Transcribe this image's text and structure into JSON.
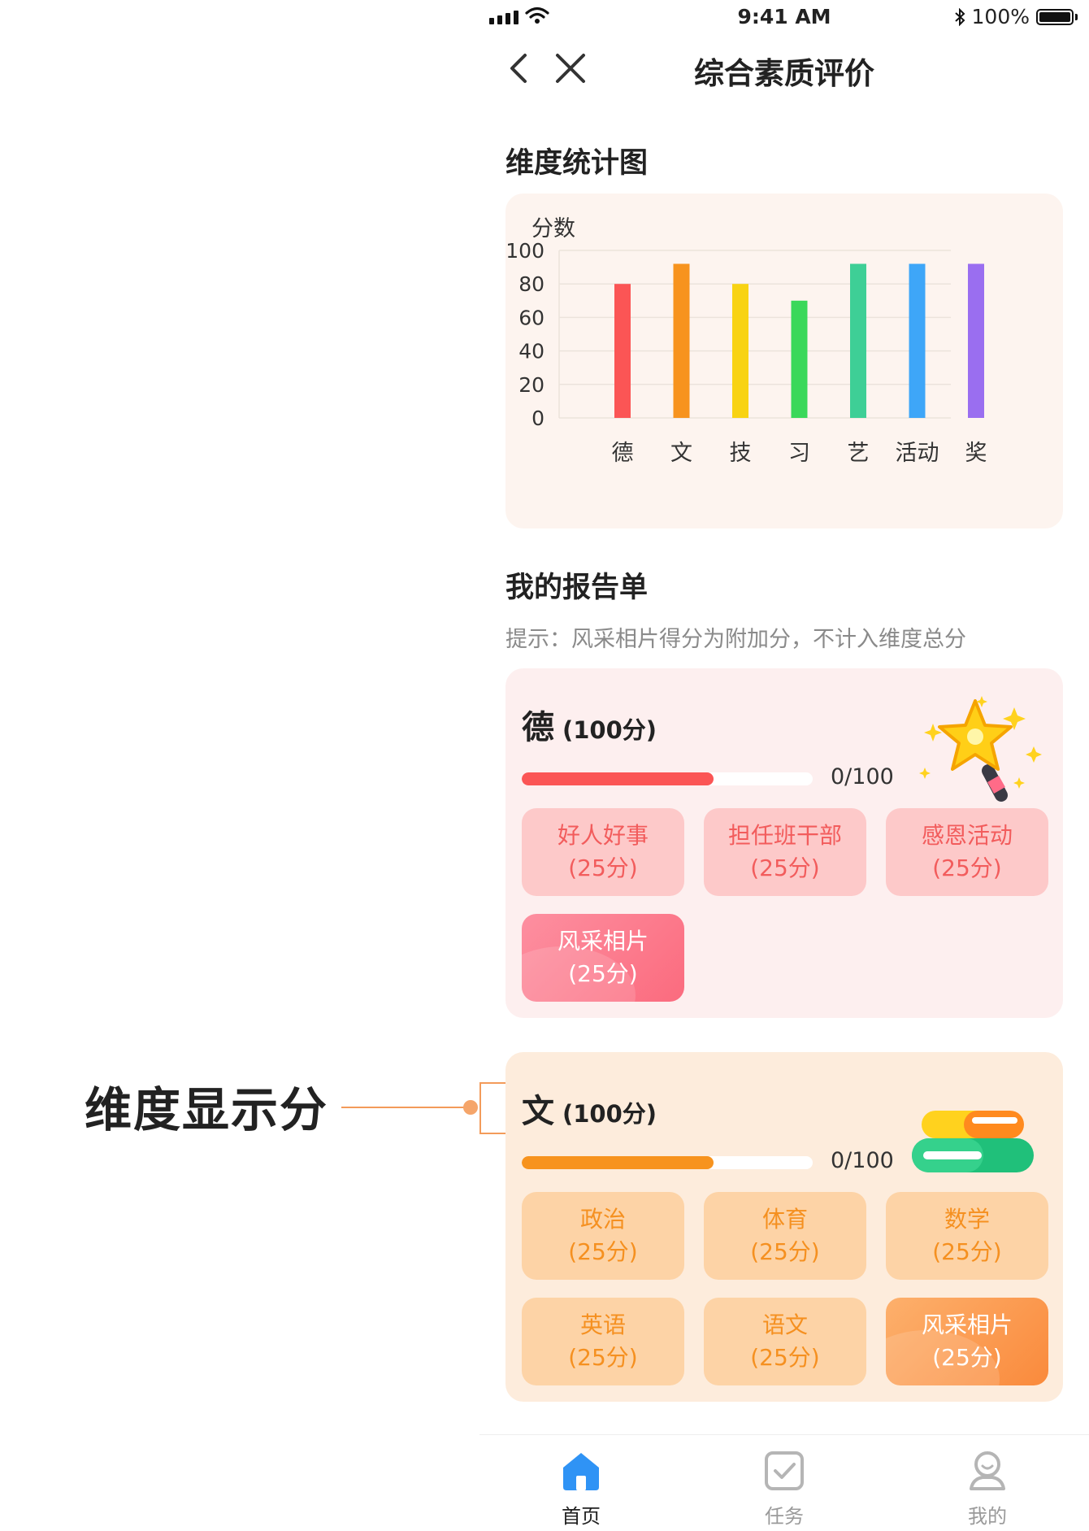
{
  "annotation": {
    "label": "维度显示分"
  },
  "statusbar": {
    "time": "9:41 AM",
    "battery": "100%"
  },
  "nav": {
    "title": "综合素质评价"
  },
  "chart_section": {
    "title": "维度统计图"
  },
  "chart_data": {
    "type": "bar",
    "ylabel": "分数",
    "ylim": [
      0,
      100
    ],
    "yticks": [
      "100",
      "80",
      "60",
      "40",
      "20",
      "0"
    ],
    "categories": [
      "德",
      "文",
      "技",
      "习",
      "艺",
      "活动",
      "奖"
    ],
    "values": [
      80,
      92,
      80,
      70,
      92,
      92,
      92
    ],
    "colors": [
      "#fb5555",
      "#f7931e",
      "#f8d313",
      "#3ad85a",
      "#3ecf96",
      "#3ea6f8",
      "#9a6ef0"
    ],
    "grid": true
  },
  "report": {
    "title": "我的报告单",
    "hint": "提示：风采相片得分为附加分，不计入维度总分",
    "cards": [
      {
        "name": "德",
        "score": "(100分)",
        "progress_text": "0/100",
        "progress": 0.66,
        "color": "#fb5555",
        "items": [
          {
            "name": "好人好事",
            "points": "(25分)"
          },
          {
            "name": "担任班干部",
            "points": "(25分)"
          },
          {
            "name": "感恩活动",
            "points": "(25分)"
          },
          {
            "name": "风采相片",
            "points": "(25分)"
          }
        ]
      },
      {
        "name": "文",
        "score": "(100分)",
        "progress_text": "0/100",
        "progress": 0.66,
        "color": "#f7931e",
        "items": [
          {
            "name": "政治",
            "points": "(25分)"
          },
          {
            "name": "体育",
            "points": "(25分)"
          },
          {
            "name": "数学",
            "points": "(25分)"
          },
          {
            "name": "英语",
            "points": "(25分)"
          },
          {
            "name": "语文",
            "points": "(25分)"
          },
          {
            "name": "风采相片",
            "points": "(25分)"
          }
        ]
      }
    ]
  },
  "tabs": [
    {
      "label": "首页",
      "icon": "home-icon",
      "active": true
    },
    {
      "label": "任务",
      "icon": "task-icon",
      "active": false
    },
    {
      "label": "我的",
      "icon": "profile-icon",
      "active": false
    }
  ]
}
